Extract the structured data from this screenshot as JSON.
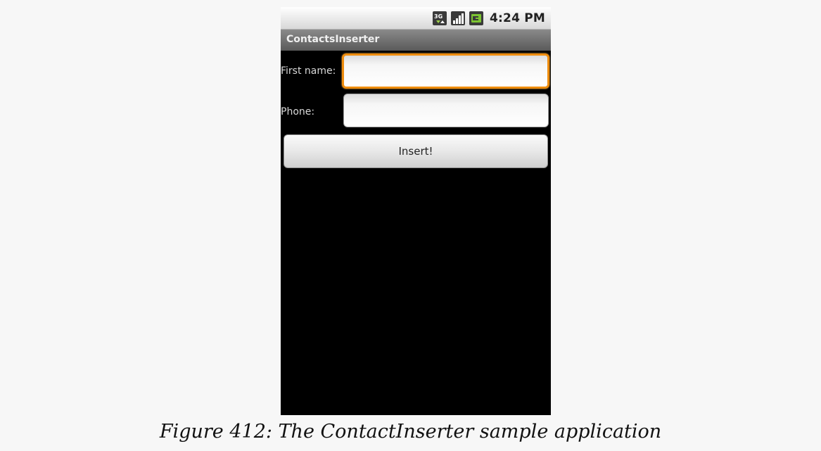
{
  "status_bar": {
    "time": "4:24 PM",
    "icons": [
      "3g-data-icon",
      "signal-strength-icon",
      "battery-charging-icon"
    ]
  },
  "app": {
    "title": "ContactsInserter"
  },
  "form": {
    "first_name_label": "First name:",
    "first_name_value": "",
    "phone_label": "Phone:",
    "phone_value": "",
    "insert_button_label": "Insert!"
  },
  "colors": {
    "focus_border": "#ef8d0e",
    "screen_background": "#000000",
    "title_bar": "#6e6e6e"
  },
  "caption": "Figure 412: The ContactInserter sample application"
}
